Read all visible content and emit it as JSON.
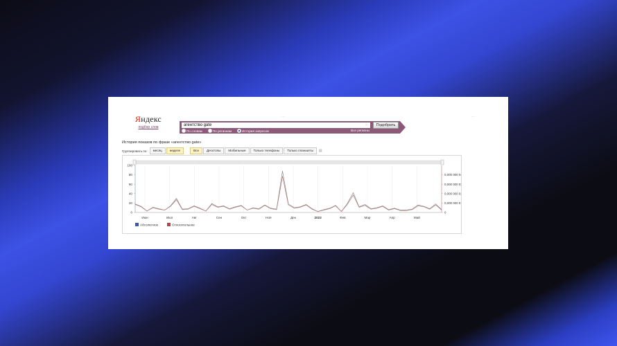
{
  "logo": {
    "first_letter": "Я",
    "rest": "ндекс",
    "subtitle": "подбор слов"
  },
  "search": {
    "value": "агентство gate",
    "submit_label": "Подобрать",
    "radios": [
      {
        "label": "По словам",
        "selected": false
      },
      {
        "label": "По регионам",
        "selected": false
      },
      {
        "label": "История запросов",
        "selected": true
      }
    ],
    "regions_label": "Все регионы"
  },
  "history": {
    "title": "История показов по фразе «агентство gate»",
    "group_label": "Группировать по:",
    "group_tabs": [
      {
        "label": "месяц",
        "selected": false
      },
      {
        "label": "неделе",
        "selected": true
      }
    ],
    "device_tabs": [
      {
        "label": "Все",
        "selected": true
      },
      {
        "label": "Десктопы",
        "selected": false
      },
      {
        "label": "Мобильные",
        "selected": false
      },
      {
        "label": "Только телефоны",
        "selected": false
      },
      {
        "label": "Только планшеты",
        "selected": false
      }
    ]
  },
  "chart_data": {
    "type": "line",
    "left_axis": {
      "ticks": [
        "0",
        "20",
        "40",
        "60",
        "80",
        "100"
      ],
      "ylim": [
        0,
        100
      ]
    },
    "right_axis": {
      "ticks": [
        "0",
        "0,000 000 01",
        "0,000 000 02",
        "0,000 000 03",
        "0,000 000 04"
      ]
    },
    "month_labels": [
      "Июн",
      "Июл",
      "Авг",
      "Сен",
      "Окт",
      "Ноя",
      "Дек",
      "2022",
      "Фев",
      "Мар",
      "Апр",
      "Май"
    ],
    "series": [
      {
        "name": "Абсолютное",
        "color": "#8c8c8c",
        "values": [
          18,
          13,
          3,
          11,
          8,
          5,
          14,
          30,
          7,
          8,
          14,
          9,
          3,
          19,
          12,
          14,
          8,
          12,
          15,
          5,
          10,
          8,
          16,
          9,
          7,
          88,
          18,
          10,
          12,
          17,
          8,
          2,
          6,
          9,
          15,
          2,
          19,
          42,
          12,
          17,
          8,
          10,
          14,
          6,
          9,
          5,
          5,
          7,
          16,
          13,
          8,
          18,
          6
        ]
      },
      {
        "name": "Относительное",
        "color": "#b07878",
        "values": [
          17,
          12,
          3,
          10,
          7,
          5,
          13,
          27,
          6,
          7,
          13,
          8,
          3,
          17,
          11,
          13,
          7,
          11,
          14,
          5,
          9,
          7,
          15,
          8,
          6,
          77,
          16,
          9,
          11,
          16,
          7,
          2,
          5,
          8,
          14,
          2,
          17,
          37,
          11,
          15,
          7,
          9,
          13,
          5,
          8,
          4,
          4,
          6,
          14,
          12,
          7,
          16,
          5
        ]
      }
    ]
  }
}
